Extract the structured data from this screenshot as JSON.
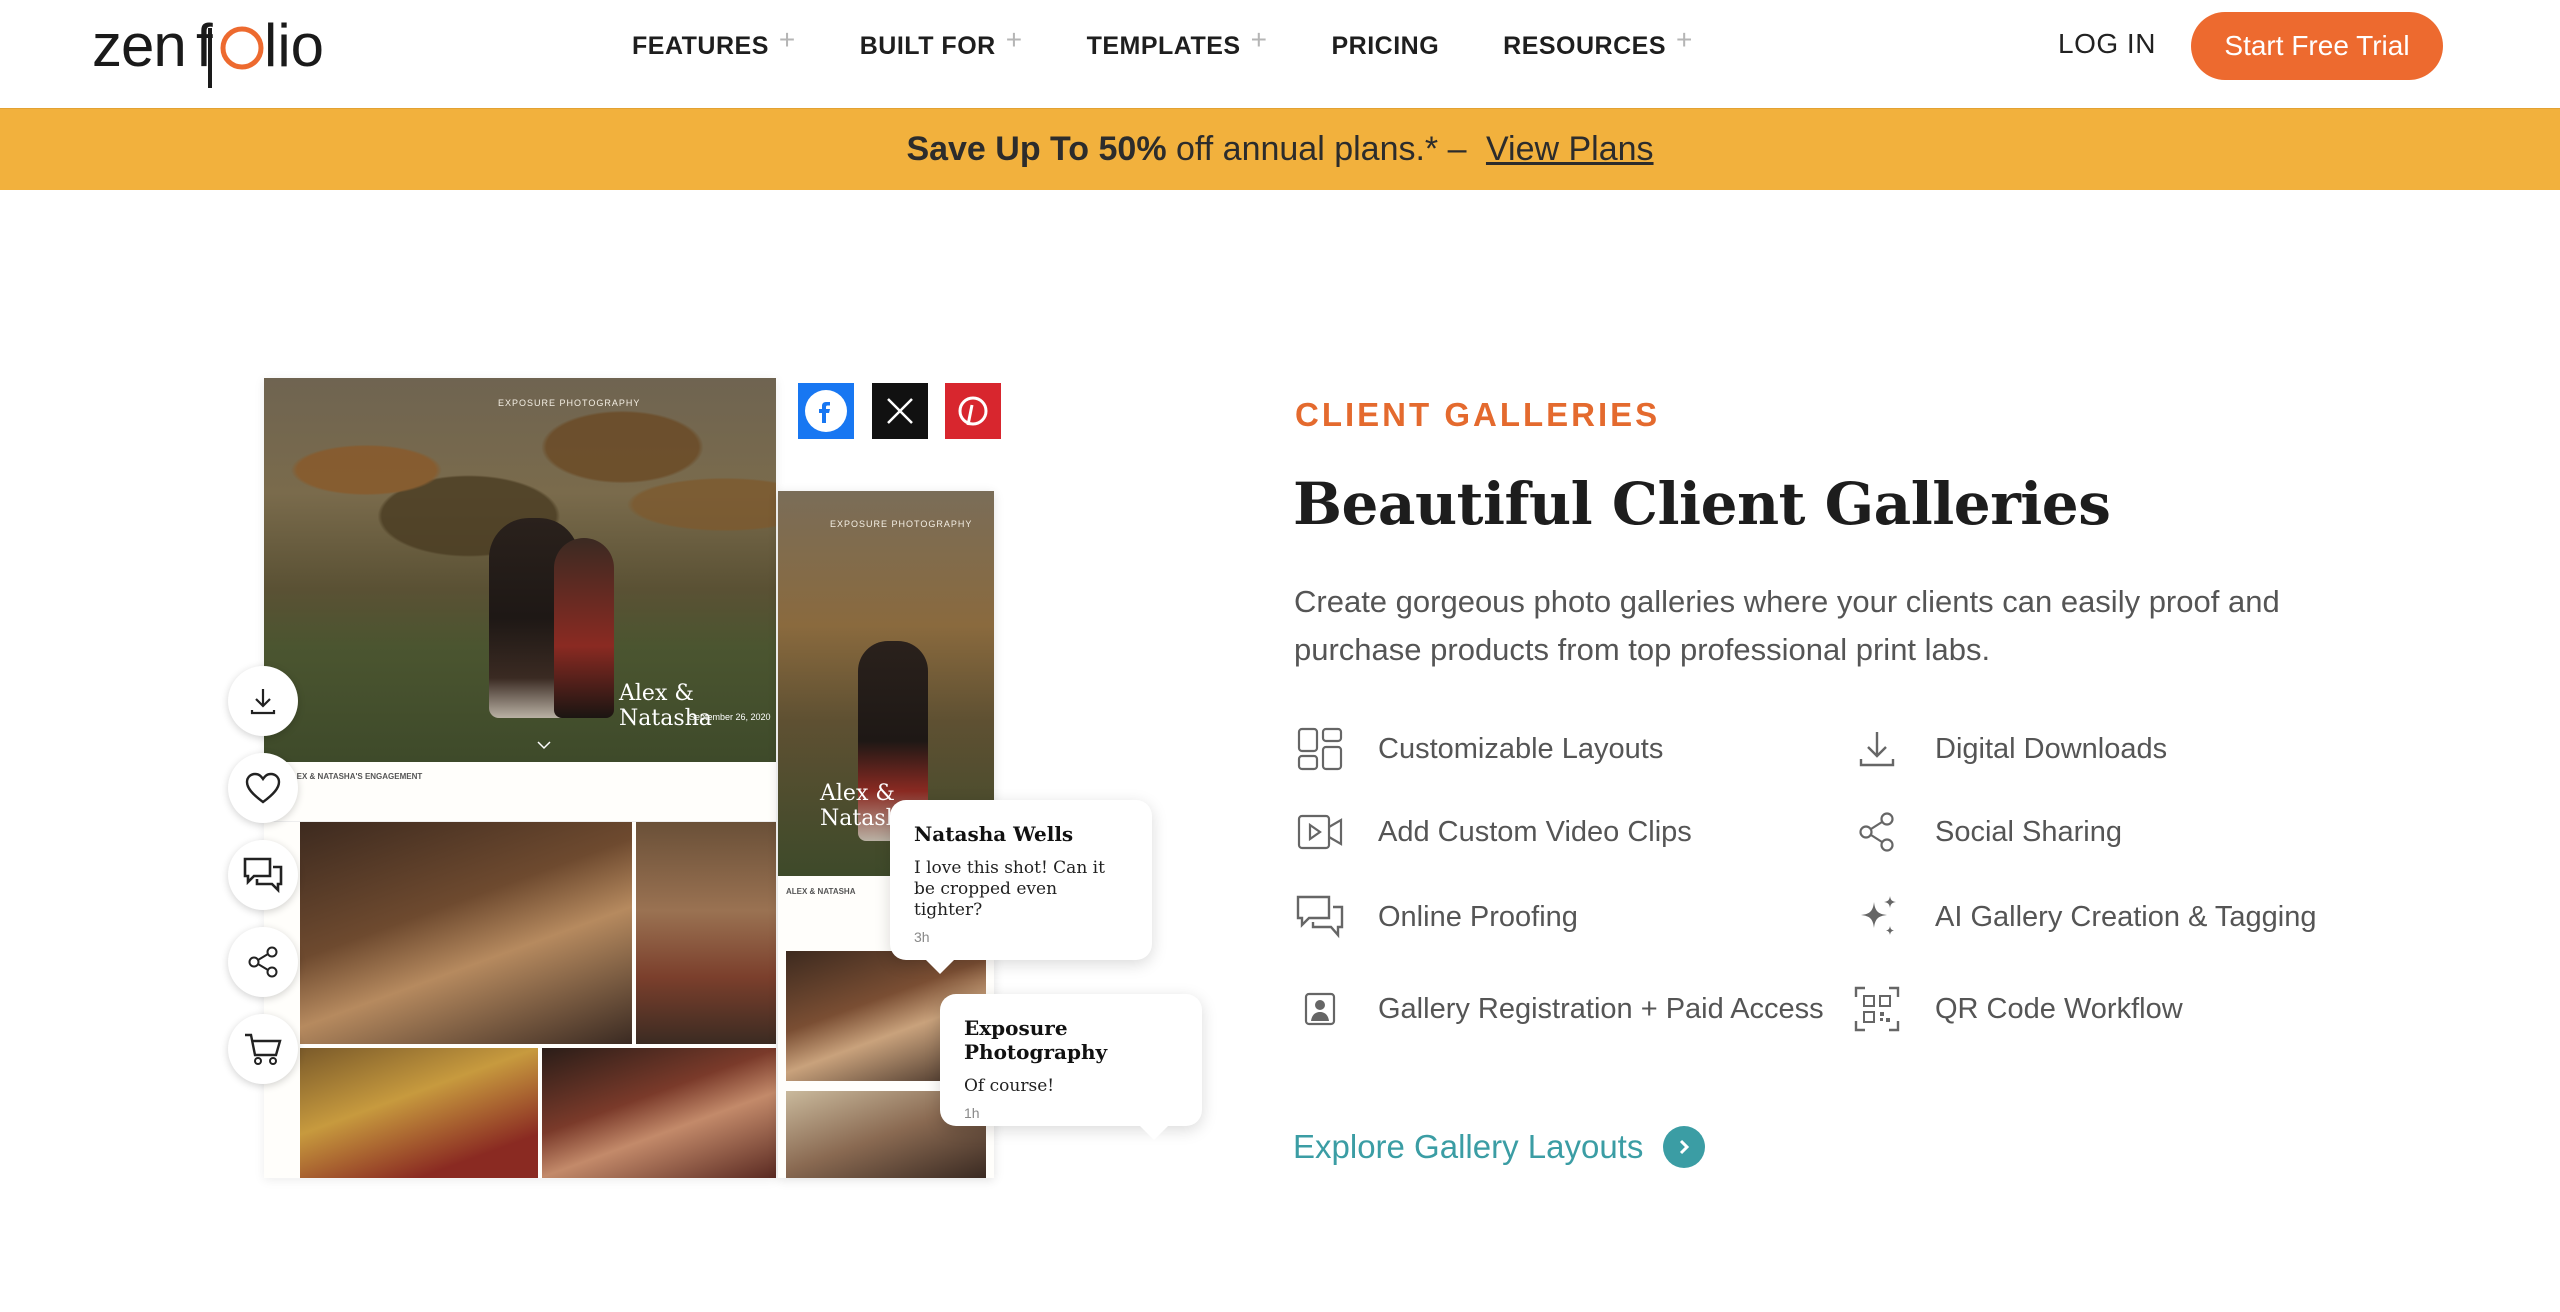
{
  "brand": {
    "logo_text": "zenfolio",
    "accent": "#ed6a2f",
    "promo_bg": "#f2b13d",
    "teal": "#3b9da4"
  },
  "nav": {
    "items": [
      {
        "label": "FEATURES",
        "has_plus": true
      },
      {
        "label": "BUILT FOR",
        "has_plus": true
      },
      {
        "label": "TEMPLATES",
        "has_plus": true
      },
      {
        "label": "PRICING",
        "has_plus": false
      },
      {
        "label": "RESOURCES",
        "has_plus": true
      }
    ],
    "plus": "+",
    "login": "LOG IN",
    "cta": "Start Free Trial"
  },
  "promo": {
    "bold": "Save Up To 50%",
    "text": " off annual plans.* – ",
    "link": "View Plans"
  },
  "mockup": {
    "hero_label": "EXPOSURE PHOTOGRAPHY",
    "hero_names": "Alex & Natasha",
    "hero_date": "September 26, 2020",
    "strip_title": "ALEX & NATASHA'S ENGAGEMENT",
    "second_label": "EXPOSURE PHOTOGRAPHY",
    "second_names": "Alex & Natasha",
    "second_strip": "ALEX & NATASHA",
    "social": [
      "facebook-icon",
      "x-icon",
      "pinterest-icon"
    ],
    "actions": [
      "download-icon",
      "heart-icon",
      "comment-icon",
      "share-icon",
      "cart-icon"
    ],
    "comments": [
      {
        "name": "Natasha Wells",
        "text": "I love this shot! Can it be cropped even tighter?",
        "time": "3h"
      },
      {
        "name": "Exposure Photography",
        "text": "Of course!",
        "time": "1h"
      }
    ]
  },
  "section": {
    "eyebrow": "CLIENT GALLERIES",
    "headline": "Beautiful Client Galleries",
    "description": "Create gorgeous photo galleries where your clients can easily proof and purchase products from top professional print labs.",
    "features": [
      {
        "icon": "layouts-icon",
        "label": "Customizable Layouts"
      },
      {
        "icon": "download-icon",
        "label": "Digital Downloads"
      },
      {
        "icon": "video-icon",
        "label": "Add Custom Video Clips"
      },
      {
        "icon": "share-icon",
        "label": "Social Sharing"
      },
      {
        "icon": "proofing-icon",
        "label": "Online Proofing"
      },
      {
        "icon": "sparkle-icon",
        "label": "AI Gallery Creation & Tagging"
      },
      {
        "icon": "portrait-lock-icon",
        "label": "Gallery Registration + Paid Access"
      },
      {
        "icon": "qr-code-icon",
        "label": "QR Code Workflow"
      }
    ],
    "cta": "Explore Gallery Layouts"
  }
}
